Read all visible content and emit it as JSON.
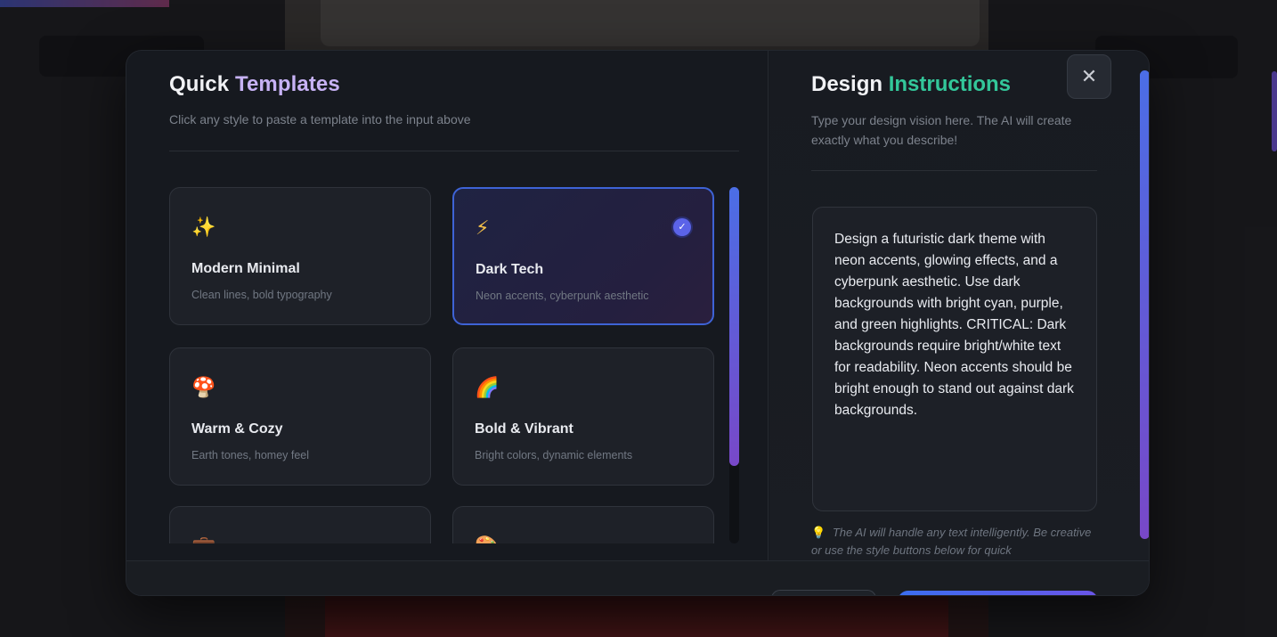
{
  "left": {
    "title_part1": "Quick",
    "title_part2": "Templates",
    "subtitle": "Click any style to paste a template into the input above",
    "cards": [
      {
        "icon": "✨",
        "icon_name": "sparkles-icon",
        "title": "Modern Minimal",
        "desc": "Clean lines, bold typography",
        "selected": false
      },
      {
        "icon": "⚡",
        "icon_name": "lightning-icon",
        "title": "Dark Tech",
        "desc": "Neon accents, cyberpunk aesthetic",
        "selected": true
      },
      {
        "icon": "🍄",
        "icon_name": "mushroom-icon",
        "title": "Warm & Cozy",
        "desc": "Earth tones, homey feel",
        "selected": false
      },
      {
        "icon": "🌈",
        "icon_name": "rainbow-icon",
        "title": "Bold & Vibrant",
        "desc": "Bright colors, dynamic elements",
        "selected": false
      },
      {
        "icon": "💼",
        "icon_name": "briefcase-icon",
        "title": "",
        "desc": "",
        "selected": false
      },
      {
        "icon": "🎨",
        "icon_name": "palette-icon",
        "title": "",
        "desc": "",
        "selected": false
      }
    ]
  },
  "right": {
    "title_part1": "Design",
    "title_part2": "Instructions",
    "subtitle": "Type your design vision here. The AI will create exactly what you describe!",
    "textarea_value": "Design a futuristic dark theme with neon accents, glowing effects, and a cyberpunk aesthetic. Use dark backgrounds with bright cyan, purple, and green highlights. CRITICAL: Dark backgrounds require bright/white text for readability. Neon accents should be bright enough to stand out against dark backgrounds.",
    "hint_icon": "💡",
    "hint": "The AI will handle any text intelligently. Be creative or use the style buttons below for quick"
  },
  "close_icon": "✕",
  "check_icon": "✓",
  "colors": {
    "accent_blue": "#3e63d6",
    "accent_purple": "#c7b2f5",
    "accent_green": "#33c79a",
    "modal_bg": "#16191f"
  }
}
